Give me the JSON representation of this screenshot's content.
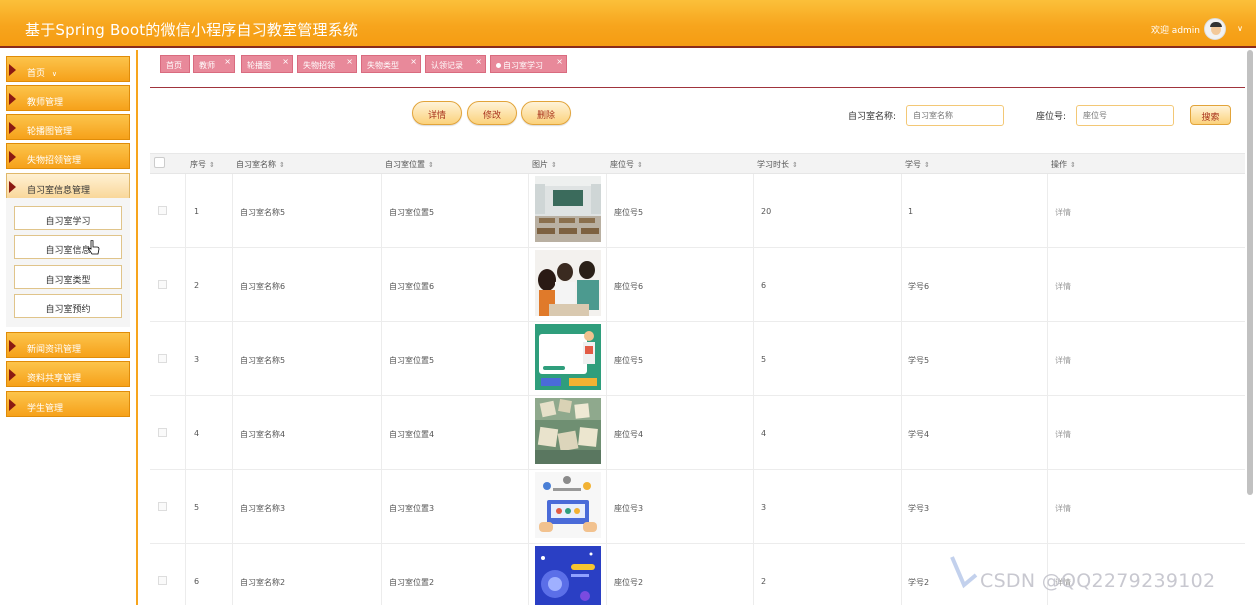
{
  "header": {
    "title": "基于Spring Boot的微信小程序自习教室管理系统",
    "welcome": "欢迎 admin",
    "caret": "∨"
  },
  "sidebar": {
    "items": [
      {
        "label": "首页",
        "dropdown": "∨"
      },
      {
        "label": "教师管理"
      },
      {
        "label": "轮播图管理"
      },
      {
        "label": "失物招领管理"
      },
      {
        "label": "自习室信息管理"
      },
      {
        "label": "新闻资讯管理"
      },
      {
        "label": "资料共享管理"
      },
      {
        "label": "学生管理"
      }
    ],
    "subitems": [
      {
        "label": "自习室学习"
      },
      {
        "label": "自习室信息"
      },
      {
        "label": "自习室类型"
      },
      {
        "label": "自习室预约"
      }
    ]
  },
  "tabs": [
    {
      "label": "首页"
    },
    {
      "label": "教师",
      "close": "×"
    },
    {
      "label": "轮播图",
      "close": "×"
    },
    {
      "label": "失物招领",
      "close": "×"
    },
    {
      "label": "失物类型",
      "close": "×"
    },
    {
      "label": "认领记录",
      "close": "×"
    },
    {
      "label": "自习室学习",
      "close": "×"
    }
  ],
  "toolbar": {
    "detail_label": "详情",
    "edit_label": "修改",
    "delete_label": "删除"
  },
  "search": {
    "room_label": "自习室名称:",
    "room_placeholder": "自习室名称",
    "seat_label": "座位号:",
    "seat_placeholder": "座位号",
    "button_label": "搜索"
  },
  "table": {
    "sort_glyph": "⇕",
    "columns": [
      "序号",
      "自习室名称",
      "自习室位置",
      "图片",
      "座位号",
      "学习时长",
      "学号",
      "操作"
    ],
    "rows": [
      {
        "index": "1",
        "room_name": "自习室名称5",
        "room_location": "自习室位置5",
        "image": "classroom",
        "seat": "座位号5",
        "duration": "20",
        "student_no": "1",
        "action": "详情"
      },
      {
        "index": "2",
        "room_name": "自习室名称6",
        "room_location": "自习室位置6",
        "image": "students-studying",
        "seat": "座位号6",
        "duration": "6",
        "student_no": "学号6",
        "action": "详情"
      },
      {
        "index": "3",
        "room_name": "自习室名称5",
        "room_location": "自习室位置5",
        "image": "online-teacher",
        "seat": "座位号5",
        "duration": "5",
        "student_no": "学号5",
        "action": "详情"
      },
      {
        "index": "4",
        "room_name": "自习室名称4",
        "room_location": "自习室位置4",
        "image": "action-letters",
        "seat": "座位号4",
        "duration": "4",
        "student_no": "学号4",
        "action": "详情"
      },
      {
        "index": "5",
        "room_name": "自习室名称3",
        "room_location": "自习室位置3",
        "image": "e-learning",
        "seat": "座位号3",
        "duration": "3",
        "student_no": "学号3",
        "action": "详情"
      },
      {
        "index": "6",
        "room_name": "自习室名称2",
        "room_location": "自习室位置2",
        "image": "space-tech",
        "seat": "座位号2",
        "duration": "2",
        "student_no": "学号2",
        "action": "详情"
      }
    ]
  },
  "watermark": "CSDN @QQ2279239102",
  "colors": {
    "header_orange": "#f7a51d",
    "tab_pink": "#e8899a",
    "accent_dark_red": "#8b2b1a"
  }
}
